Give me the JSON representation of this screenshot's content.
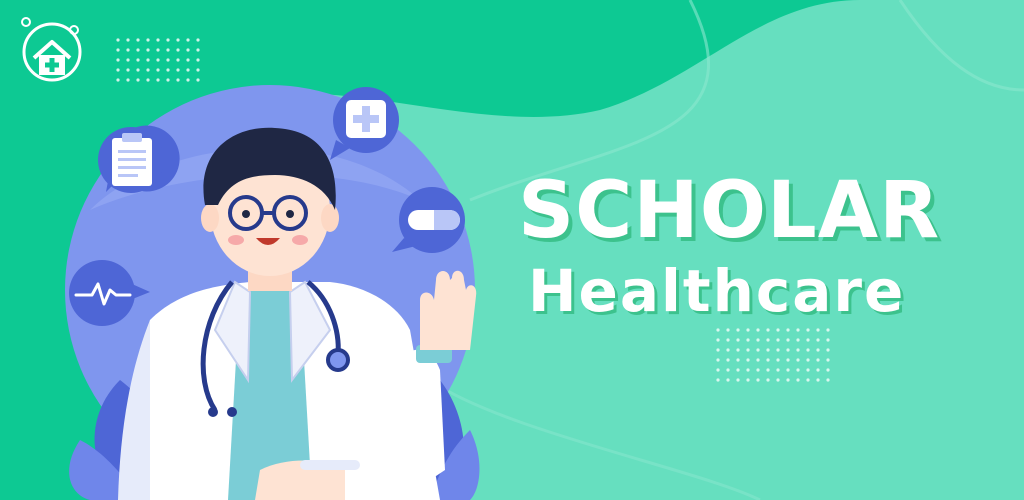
{
  "brand": {
    "title": "SCHOLAR",
    "subtitle": "Healthcare",
    "logo_icon": "home-medical-stethoscope-icon"
  },
  "colors": {
    "background": "#0dc993",
    "blob": "#66dfbf",
    "circle": "#7f96ee",
    "bubble": "#4e66d6",
    "title_text": "#ffffff",
    "title_shadow": "#3cc28d"
  },
  "icons": {
    "clipboard": "clipboard-icon",
    "first_aid": "first-aid-cross-icon",
    "pill": "pill-icon",
    "heartbeat": "heartbeat-icon"
  }
}
